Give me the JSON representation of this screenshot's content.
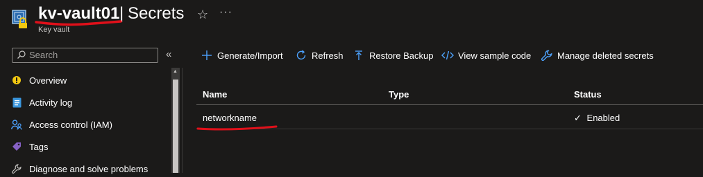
{
  "header": {
    "resource_name": "kv-vault01",
    "separator": "|",
    "page_title": "Secrets",
    "resource_type": "Key vault",
    "star_glyph": "☆",
    "more_glyph": "···",
    "icon": "key-vault-icon"
  },
  "sidebar": {
    "search_placeholder": "Search",
    "collapse_glyph": "«",
    "items": [
      {
        "label": "Overview",
        "icon": "overview-icon"
      },
      {
        "label": "Activity log",
        "icon": "activity-log-icon"
      },
      {
        "label": "Access control (IAM)",
        "icon": "access-control-icon"
      },
      {
        "label": "Tags",
        "icon": "tags-icon"
      },
      {
        "label": "Diagnose and solve problems",
        "icon": "wrench-icon"
      }
    ]
  },
  "toolbar": {
    "items": [
      {
        "label": "Generate/Import",
        "icon": "plus-icon"
      },
      {
        "label": "Refresh",
        "icon": "refresh-icon"
      },
      {
        "label": "Restore Backup",
        "icon": "upload-icon"
      },
      {
        "label": "View sample code",
        "icon": "code-icon"
      },
      {
        "label": "Manage deleted secrets",
        "icon": "wrench-icon"
      }
    ]
  },
  "table": {
    "columns": [
      "Name",
      "Type",
      "Status"
    ],
    "rows": [
      {
        "name": "networkname",
        "type": "",
        "status": "Enabled",
        "status_glyph": "✓"
      }
    ]
  },
  "colors": {
    "background": "#1b1a19",
    "accent": "#4da3ff",
    "annotation_red": "#e0101a"
  }
}
